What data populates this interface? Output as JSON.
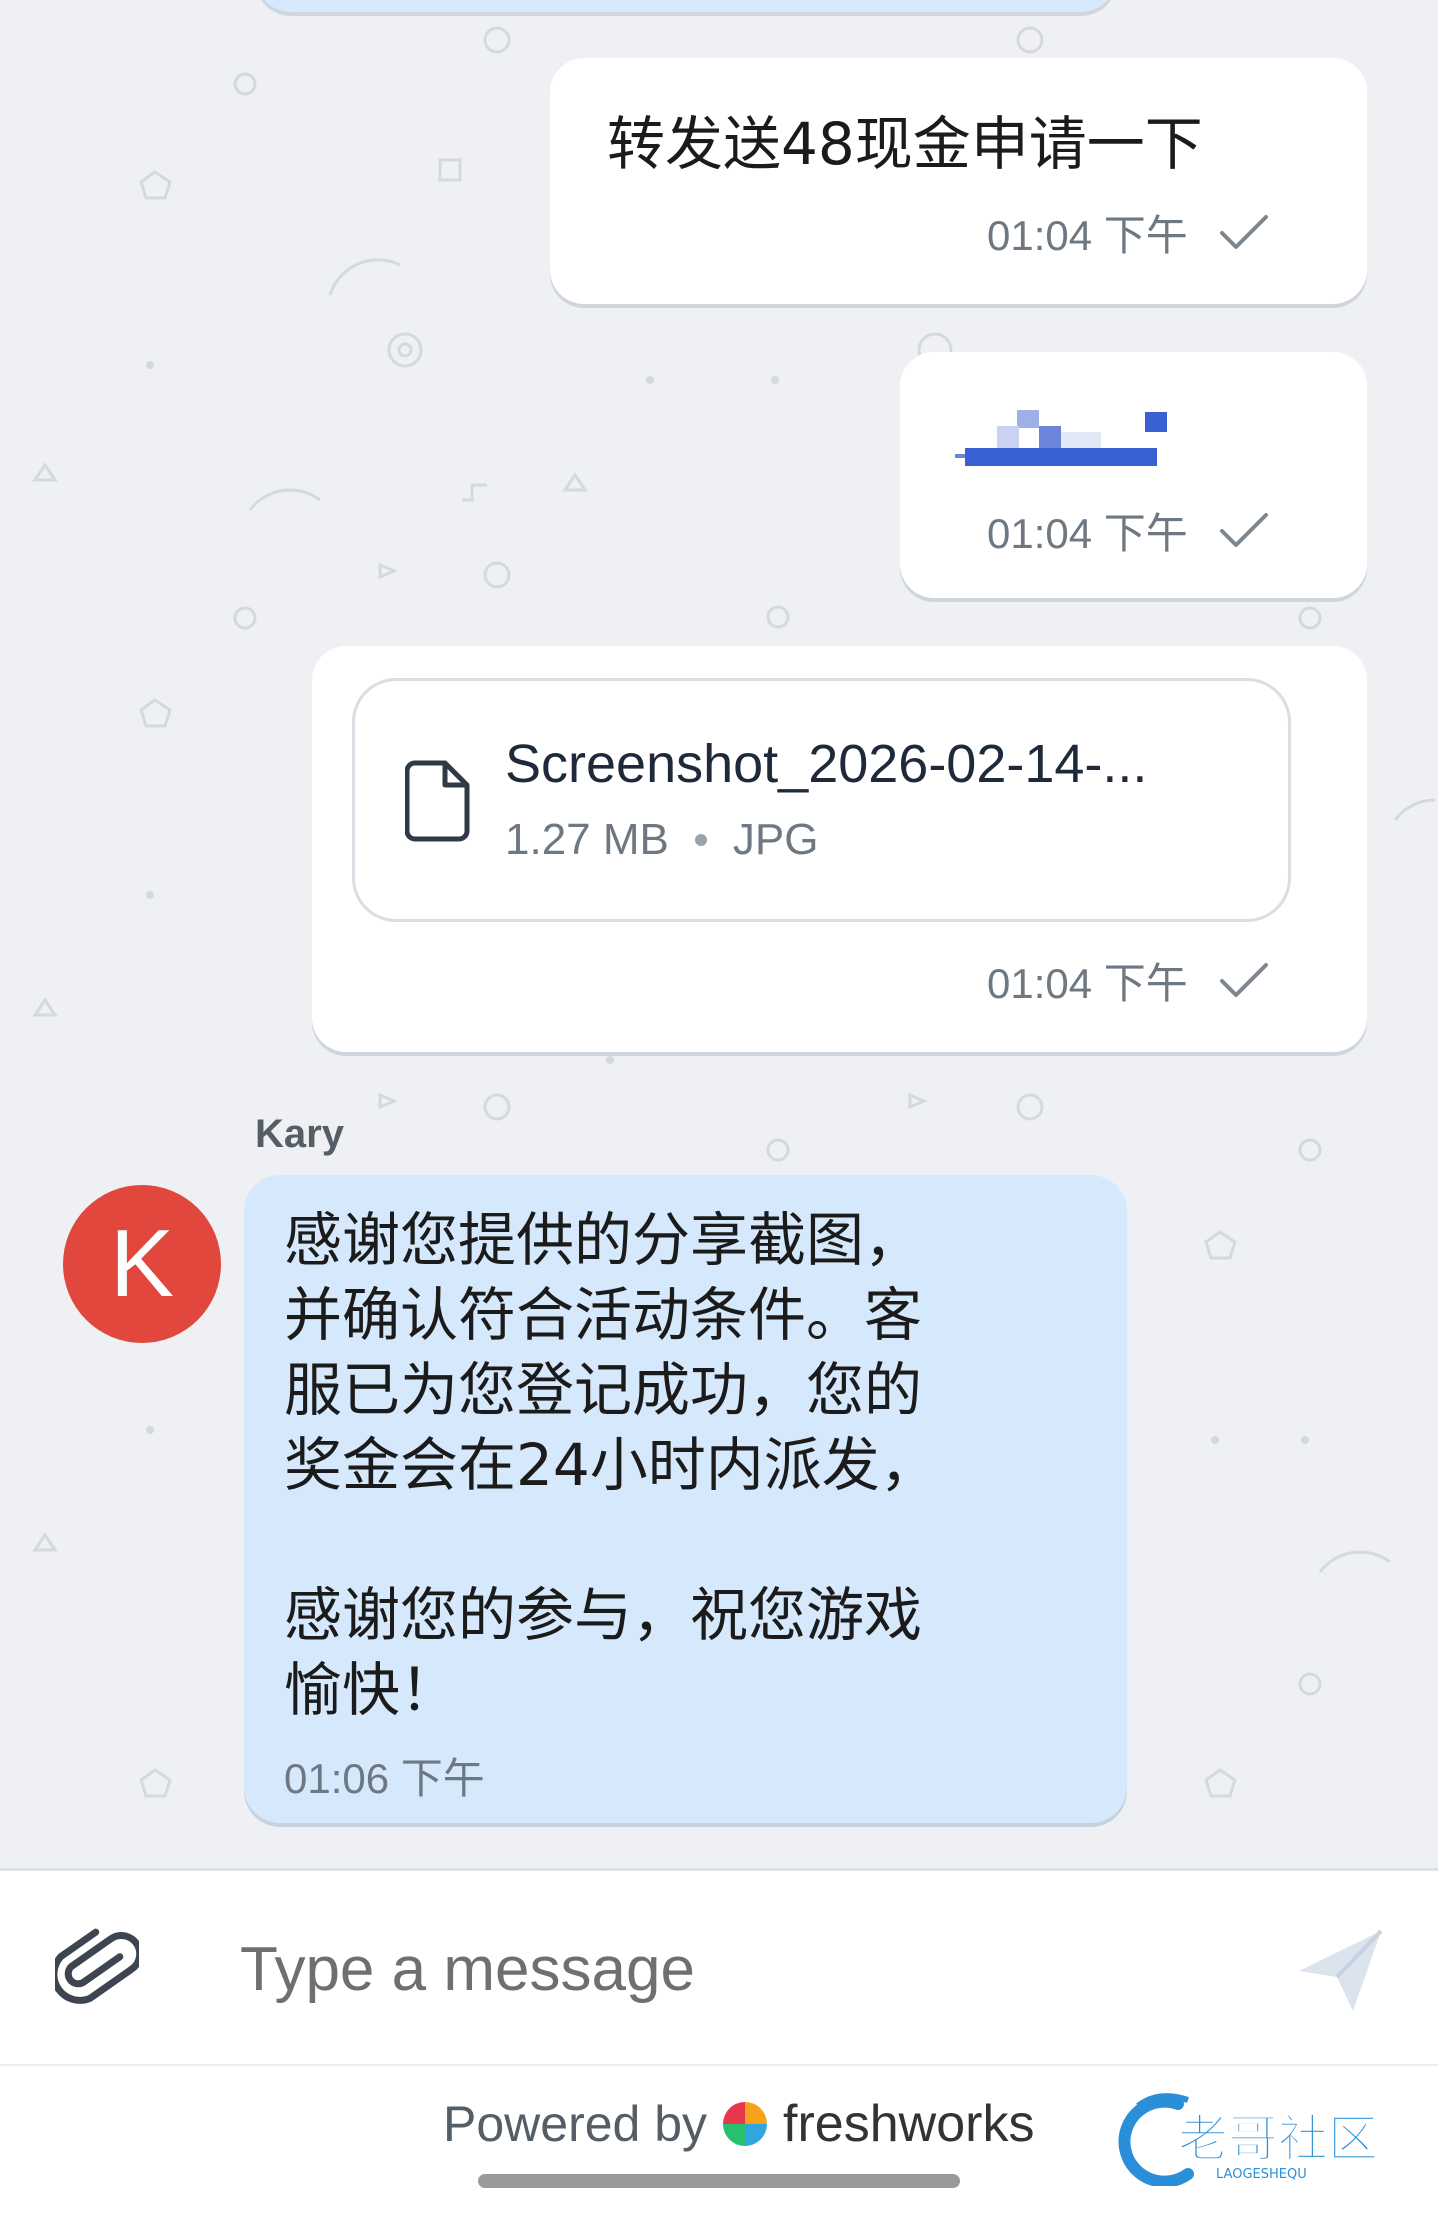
{
  "messages": [
    {
      "text": "转发送48现金申请一下",
      "time": "01:04 下午"
    },
    {
      "type": "image",
      "time": "01:04 下午"
    },
    {
      "type": "file",
      "file_name": "Screenshot_2026-02-14-...",
      "size": "1.27 MB",
      "format": "JPG",
      "time": "01:04 下午"
    }
  ],
  "agent": {
    "name": "Kary",
    "initial": "K",
    "message": "感谢您提供的分享截图，\n并确认符合活动条件。客\n服已为您登记成功，您的\n奖金会在24小时内派发，\n\n感谢您的参与，祝您游戏\n愉快！",
    "time": "01:06 下午",
    "avatar_color": "#e1473d"
  },
  "composer": {
    "placeholder": "Type a message"
  },
  "footer": {
    "powered_by": "Powered by",
    "brand": "freshworks",
    "watermark": "老哥社区",
    "watermark_sub": "LAOGESHEQU"
  },
  "colors": {
    "agent_bubble": "#d6e8fb",
    "user_bubble": "#ffffff",
    "background": "#eef0f3"
  },
  "icons": [
    "check-icon",
    "file-icon",
    "paperclip-icon",
    "send-icon",
    "freshworks-logo"
  ]
}
